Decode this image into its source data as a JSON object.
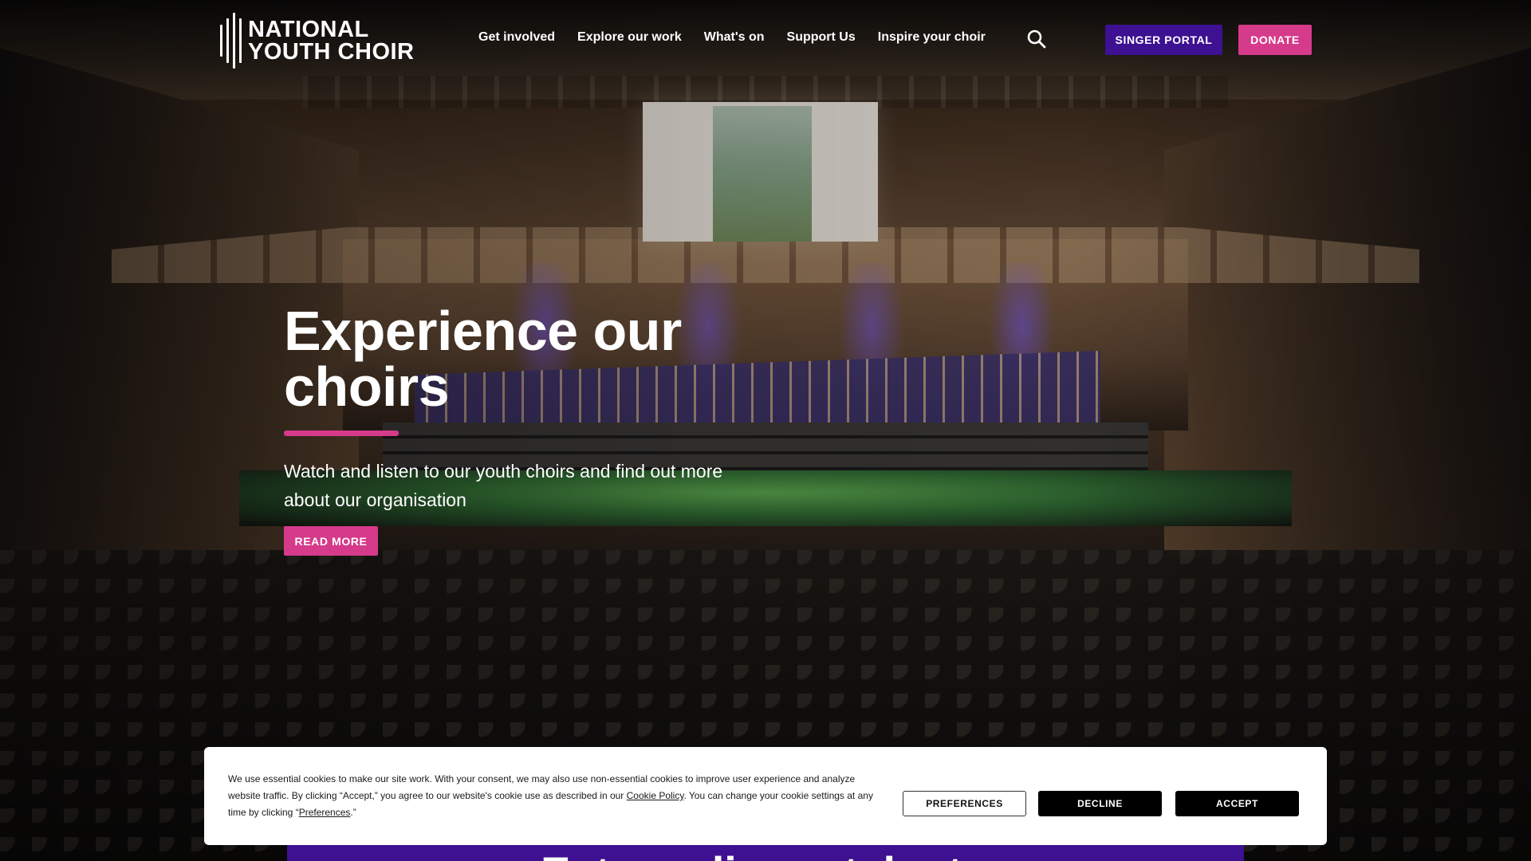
{
  "header": {
    "logo_line1": "NATIONAL",
    "logo_line2": "YOUTH CHOIR",
    "nav": [
      {
        "label": "Get involved"
      },
      {
        "label": "Explore our work"
      },
      {
        "label": "What's on"
      },
      {
        "label": "Support Us"
      },
      {
        "label": "Inspire your choir"
      }
    ],
    "search_icon": "search-icon",
    "singer_portal_label": "SINGER PORTAL",
    "donate_label": "DONATE"
  },
  "hero": {
    "title": "Experience our choirs",
    "subtitle": "Watch and listen to our youth choirs and find out more about our organisation",
    "cta_label": "READ MORE"
  },
  "next_section": {
    "heading_partial": "Extraordinary talent"
  },
  "cookie_banner": {
    "text_before_link": "We use essential cookies to make our site work. With your consent, we may also use non-essential cookies to improve user experience and analyze website traffic. By clicking “Accept,” you agree to our website's cookie use as described in our ",
    "policy_link": "Cookie Policy",
    "text_middle": ". You can change your cookie settings at any time by clicking “",
    "preferences_link": "Preferences",
    "text_end": ".”",
    "preferences_label": "PREFERENCES",
    "decline_label": "DECLINE",
    "accept_label": "ACCEPT"
  },
  "colors": {
    "brand_purple": "#3d1191",
    "brand_pink": "#d63a8a",
    "text_white": "#ffffff"
  }
}
